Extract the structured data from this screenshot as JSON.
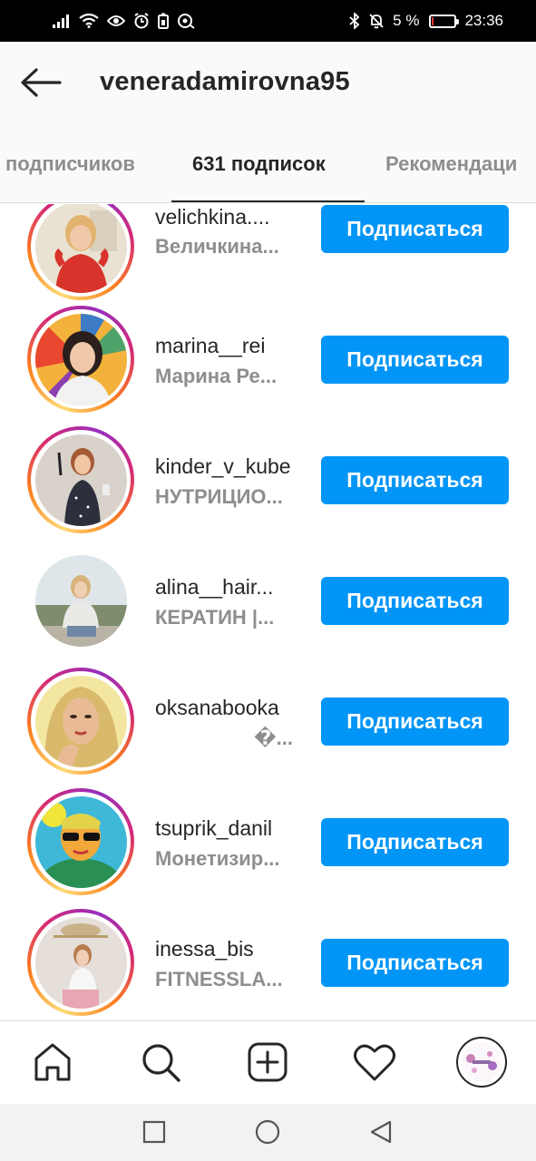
{
  "status_bar": {
    "battery_percent_text": "5 %",
    "battery_level": 0.05,
    "time": "23:36",
    "battery_color": "#e53935"
  },
  "header": {
    "title": "veneradamirovna95",
    "back_icon": "arrow-left-icon"
  },
  "tabs": [
    {
      "label": "подписчиков",
      "active": false
    },
    {
      "label": "631 подписок",
      "active": true
    },
    {
      "label": "Рекомендаци",
      "active": false
    }
  ],
  "follow_label": "Подписаться",
  "accent_color": "#0095f6",
  "users": [
    {
      "username": "velichkina....",
      "fullname": "Величкина...",
      "ring": true
    },
    {
      "username": "marina__rei",
      "fullname": "Марина Ре...",
      "ring": true
    },
    {
      "username": "kinder_v_kube",
      "fullname": "НУТРИЦИО...",
      "ring": true
    },
    {
      "username": "alina__hair...",
      "fullname": "КЕРАТИН |...",
      "ring": false
    },
    {
      "username": "oksanabooka",
      "fullname": "�...",
      "ring": true
    },
    {
      "username": "tsuprik_danil",
      "fullname": "Монетизир...",
      "ring": true
    },
    {
      "username": "inessa_bis",
      "fullname": "FITNESSLA...",
      "ring": true
    }
  ],
  "bottom_nav": [
    "home-icon",
    "search-icon",
    "add-post-icon",
    "heart-icon",
    "profile-icon"
  ],
  "system_nav": [
    "recents-square-icon",
    "home-circle-icon",
    "back-triangle-icon"
  ]
}
